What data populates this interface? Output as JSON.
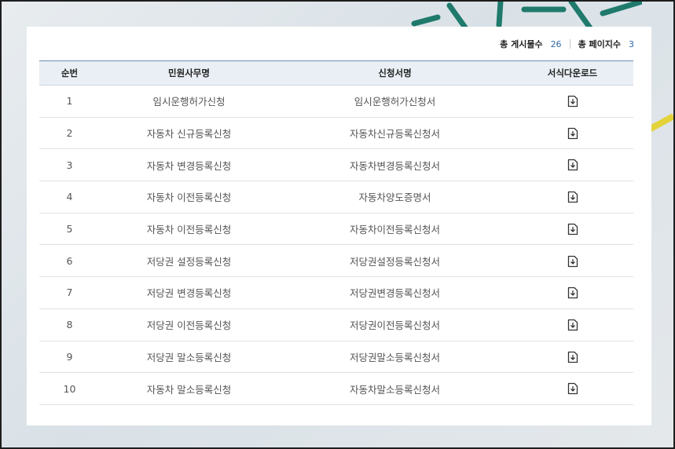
{
  "summary": {
    "total_posts_label": "총 게시물수",
    "total_posts_value": "26",
    "total_pages_label": "총 페이지수",
    "total_pages_value": "3"
  },
  "table": {
    "headers": [
      "순번",
      "민원사무명",
      "신청서명",
      "서식다운로드"
    ],
    "rows": [
      {
        "no": "1",
        "service": "임시운행허가신청",
        "form": "임시운행허가신청서"
      },
      {
        "no": "2",
        "service": "자동차 신규등록신청",
        "form": "자동차신규등록신청서"
      },
      {
        "no": "3",
        "service": "자동차 변경등록신청",
        "form": "자동차변경등록신청서"
      },
      {
        "no": "4",
        "service": "자동차 이전등록신청",
        "form": "자동차양도증명서"
      },
      {
        "no": "5",
        "service": "자동차 이전등록신청",
        "form": "자동차이전등록신청서"
      },
      {
        "no": "6",
        "service": "저당권 설정등록신청",
        "form": "저당권설정등록신청서"
      },
      {
        "no": "7",
        "service": "저당권 변경등록신청",
        "form": "저당권변경등록신청서"
      },
      {
        "no": "8",
        "service": "저당권 이전등록신청",
        "form": "저당권이전등록신청서"
      },
      {
        "no": "9",
        "service": "저당권 말소등록신청",
        "form": "저당권말소등록신청서"
      },
      {
        "no": "10",
        "service": "자동차 말소등록신청",
        "form": "자동차말소등록신청서"
      }
    ],
    "download_icon": "file-download-icon"
  },
  "colors": {
    "accent": "#2f6aa5",
    "header_bg": "#e9eff5",
    "header_border": "#6b8fb3"
  }
}
